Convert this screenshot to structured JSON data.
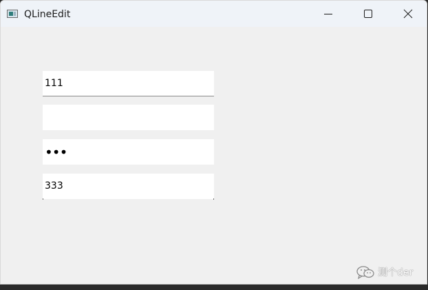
{
  "window": {
    "title": "QLineEdit"
  },
  "fields": [
    {
      "value": "111"
    },
    {
      "value": ""
    },
    {
      "value": "•••"
    },
    {
      "value": "333"
    }
  ],
  "watermark": {
    "text": "测个der"
  },
  "icons": {
    "app": "qt-window-icon",
    "minimize": "minimize-icon",
    "maximize": "maximize-icon",
    "close": "close-icon",
    "watermark": "wechat-icon"
  },
  "colors": {
    "window_bg": "#f0f0f0",
    "titlebar_bg": "#eff3f8",
    "field_bg": "#ffffff"
  }
}
